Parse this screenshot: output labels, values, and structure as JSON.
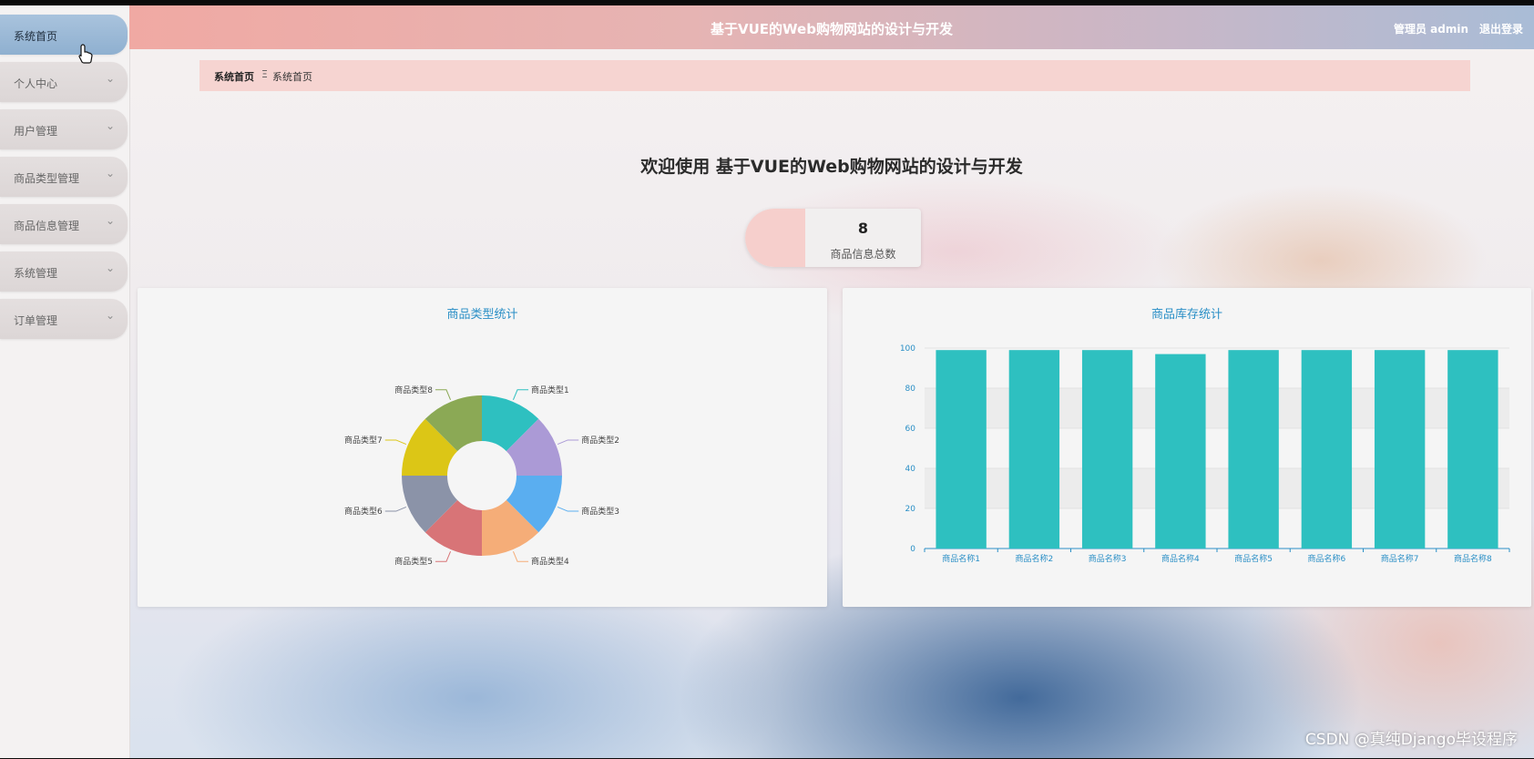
{
  "header": {
    "title": "基于VUE的Web购物网站的设计与开发",
    "admin_label": "管理员 admin",
    "logout_label": "退出登录"
  },
  "sidebar": {
    "items": [
      {
        "label": "系统首页",
        "active": true
      },
      {
        "label": "个人中心",
        "has_children": true
      },
      {
        "label": "用户管理",
        "has_children": true
      },
      {
        "label": "商品类型管理",
        "has_children": true
      },
      {
        "label": "商品信息管理",
        "has_children": true
      },
      {
        "label": "系统管理",
        "has_children": true
      },
      {
        "label": "订单管理",
        "has_children": true
      }
    ]
  },
  "breadcrumb": {
    "home": "系统首页",
    "separator": "Ξ",
    "current": "系统首页"
  },
  "welcome": "欢迎使用 基于VUE的Web购物网站的设计与开发",
  "stat": {
    "value": "8",
    "label": "商品信息总数"
  },
  "watermark": "CSDN @真纯Django毕设程序",
  "colors": {
    "accent": "#2a8fc6",
    "bar": "#2ec0c0"
  },
  "chart_data": [
    {
      "type": "pie",
      "title": "商品类型统计",
      "donut": true,
      "categories": [
        "商品类型1",
        "商品类型2",
        "商品类型3",
        "商品类型4",
        "商品类型5",
        "商品类型6",
        "商品类型7",
        "商品类型8"
      ],
      "values": [
        1,
        1,
        1,
        1,
        1,
        1,
        1,
        1
      ],
      "colors": [
        "#2ec0c0",
        "#ab9ad6",
        "#5aaef0",
        "#f5ad78",
        "#d87477",
        "#8b93a8",
        "#dcc616",
        "#8ba955"
      ]
    },
    {
      "type": "bar",
      "title": "商品库存统计",
      "categories": [
        "商品名称1",
        "商品名称2",
        "商品名称3",
        "商品名称4",
        "商品名称5",
        "商品名称6",
        "商品名称7",
        "商品名称8"
      ],
      "values": [
        99,
        99,
        99,
        97,
        99,
        99,
        99,
        99
      ],
      "ylim": [
        0,
        100
      ],
      "yticks": [
        0,
        20,
        40,
        60,
        80,
        100
      ],
      "grid": true
    }
  ]
}
